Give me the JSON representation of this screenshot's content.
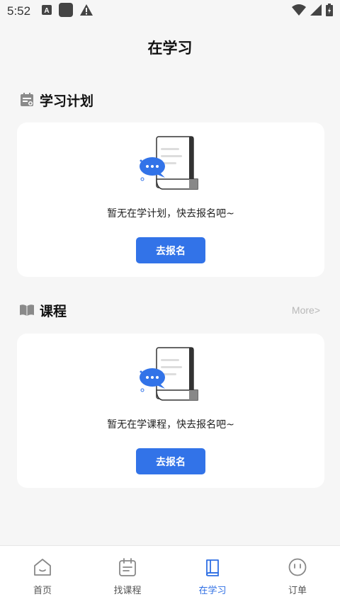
{
  "status_bar": {
    "time": "5:52"
  },
  "page": {
    "title": "在学习"
  },
  "plan_section": {
    "title": "学习计划",
    "icon": "calendar-list-icon",
    "empty_text": "暂无在学计划，快去报名吧~",
    "button_label": "去报名"
  },
  "course_section": {
    "title": "课程",
    "icon": "open-book-icon",
    "more_label": "More>",
    "empty_text": "暂无在学课程，快去报名吧~",
    "button_label": "去报名"
  },
  "tabbar": {
    "items": [
      {
        "label": "首页",
        "icon": "home-icon",
        "active": false
      },
      {
        "label": "找课程",
        "icon": "calendar-icon",
        "active": false
      },
      {
        "label": "在学习",
        "icon": "book-icon",
        "active": true
      },
      {
        "label": "订单",
        "icon": "smile-face-icon",
        "active": false
      }
    ]
  },
  "colors": {
    "accent": "#3273e8",
    "background": "#f6f6f6",
    "card": "#ffffff",
    "muted": "#b8b8b8"
  }
}
